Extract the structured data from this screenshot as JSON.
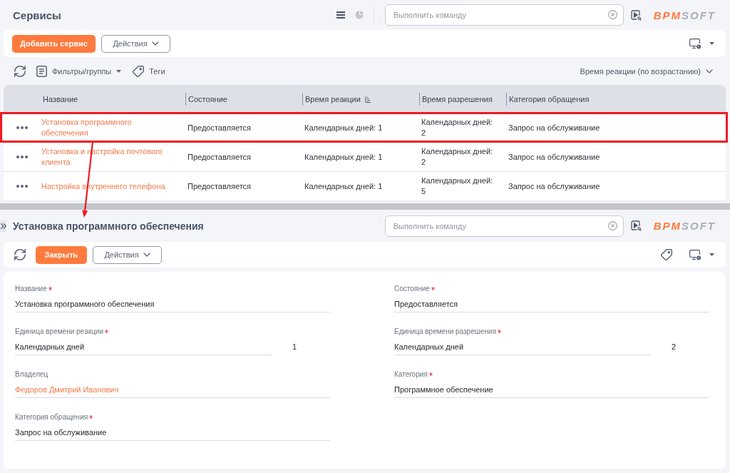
{
  "list_page": {
    "title": "Сервисы",
    "command_search": {
      "placeholder": "Выполнить команду"
    },
    "logo": {
      "accent": "BPM",
      "rest": "SOFT"
    },
    "add_button": "Добавить сервис",
    "actions_button": "Действия",
    "filters_button": "Фильтры/группы",
    "tags_button": "Теги",
    "sort_dropdown": "Время реакции (по возрастанию)",
    "table": {
      "columns": [
        {
          "label": "Название",
          "sorted": false
        },
        {
          "label": "Состояние",
          "sorted": false
        },
        {
          "label": "Время реакции",
          "sorted": true
        },
        {
          "label": "Время разрешения",
          "sorted": false
        },
        {
          "label": "Категория обращения",
          "sorted": false
        }
      ],
      "rows": [
        {
          "highlighted": true,
          "cells": [
            "Установка программного обеспечения",
            "Предоставляется",
            "Календарных дней: 1",
            "Календарных дней: 2",
            "Запрос на обслуживание"
          ]
        },
        {
          "highlighted": false,
          "cells": [
            "Установка и настройка почтового клиента",
            "Предоставляется",
            "Календарных дней: 1",
            "Календарных дней: 2",
            "Запрос на обслуживание"
          ]
        },
        {
          "highlighted": false,
          "cells": [
            "Настройка внутреннего телефона",
            "Предоставляется",
            "Календарных дней: 1",
            "Календарных дней: 5",
            "Запрос на обслуживание"
          ]
        }
      ]
    }
  },
  "detail_page": {
    "title": "Установка программного обеспечения",
    "command_search": {
      "placeholder": "Выполнить команду"
    },
    "logo": {
      "accent": "BPM",
      "rest": "SOFT"
    },
    "close_button": "Закрыть",
    "actions_button": "Действия",
    "fields": [
      {
        "kind": "text",
        "label": "Название",
        "required": true,
        "value": "Установка программного обеспечения"
      },
      {
        "kind": "text",
        "label": "Состояние",
        "required": true,
        "value": "Предоставляется"
      },
      {
        "kind": "unit",
        "label": "Единица времени реакции",
        "required": true,
        "value": "Календарных дней",
        "amount": "1"
      },
      {
        "kind": "unit",
        "label": "Единица времени разрешения",
        "required": true,
        "value": "Календарных дней",
        "amount": "2"
      },
      {
        "kind": "link",
        "label": "Владелец",
        "required": false,
        "value": "Федоров Дмитрий Иванович"
      },
      {
        "kind": "text",
        "label": "Категория",
        "required": true,
        "value": "Программное обеспечение"
      },
      {
        "kind": "text",
        "label": "Категория обращения",
        "required": true,
        "value": "Запрос на обслуживание"
      }
    ]
  }
}
